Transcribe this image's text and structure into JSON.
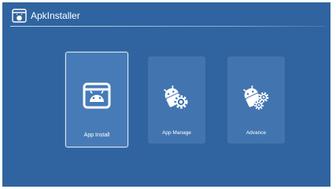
{
  "app": {
    "title": "ApkInstaller",
    "logo_icon": "apk-installer-logo-icon"
  },
  "tiles": [
    {
      "label": "App Install",
      "icon": "android-box-icon",
      "selected": true
    },
    {
      "label": "App Manage",
      "icon": "android-gear-icon",
      "selected": false
    },
    {
      "label": "Advance",
      "icon": "android-gears-icon",
      "selected": false
    }
  ],
  "colors": {
    "background": "#2f64a0",
    "tile": "#4275b0",
    "tile_selected": "#477bb7",
    "text": "#ffffff"
  }
}
